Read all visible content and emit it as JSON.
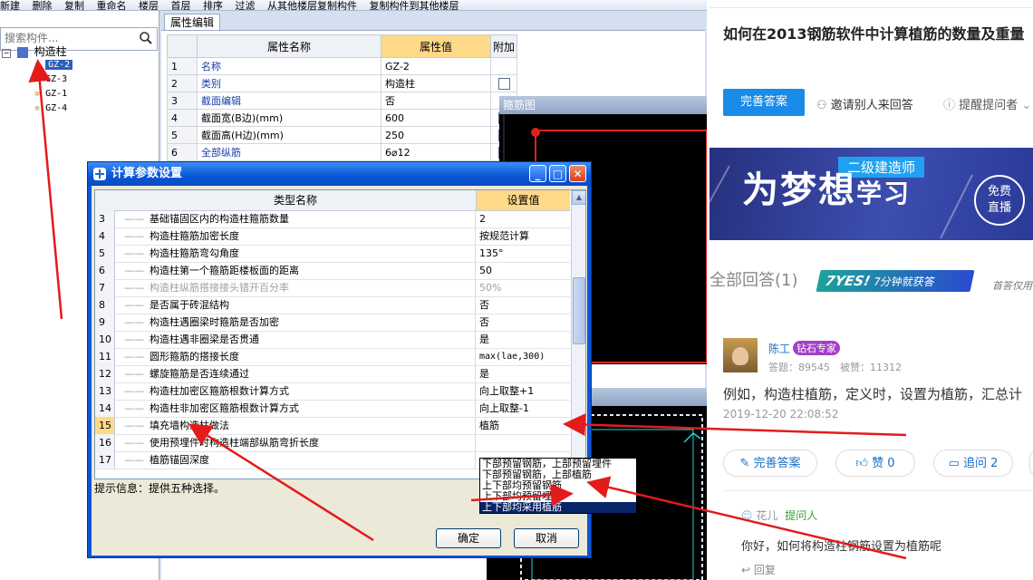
{
  "toolbar": {
    "items": [
      "新建",
      "删除",
      "复制",
      "重命名",
      "楼层",
      "首层",
      "排序",
      "过滤",
      "从其他楼层复制构件",
      "复制构件到其他楼层"
    ]
  },
  "left": {
    "search_placeholder": "搜索构件...",
    "tree_root": "构造柱",
    "tree_items": [
      "GZ-2",
      "GZ-3",
      "GZ-1",
      "GZ-4"
    ],
    "selected_index": 0
  },
  "props": {
    "tab_label": "属性编辑",
    "headers": [
      "属性名称",
      "属性值",
      "附加"
    ],
    "rows": [
      {
        "num": "1",
        "name": "名称",
        "value": "GZ-2",
        "check": false,
        "blue": true
      },
      {
        "num": "2",
        "name": "类别",
        "value": "构造柱",
        "check": true,
        "blue": true
      },
      {
        "num": "3",
        "name": "截面编辑",
        "value": "否",
        "check": false,
        "blue": true
      },
      {
        "num": "4",
        "name": "截面宽(B边)(mm)",
        "value": "600",
        "check": true,
        "blue": false
      },
      {
        "num": "5",
        "name": "截面高(H边)(mm)",
        "value": "250",
        "check": true,
        "blue": false
      },
      {
        "num": "6",
        "name": "全部纵筋",
        "value": "6⌀12",
        "check": true,
        "blue": true
      }
    ]
  },
  "preview": {
    "title": "箍筋图"
  },
  "dialog": {
    "title": "计算参数设置",
    "col_name": "类型名称",
    "col_value": "设置值",
    "rows": [
      {
        "num": "3",
        "name": "基础锚固区内的构造柱箍筋数量",
        "value": "2",
        "dim": false
      },
      {
        "num": "4",
        "name": "构造柱箍筋加密长度",
        "value": "按规范计算",
        "dim": false
      },
      {
        "num": "5",
        "name": "构造柱箍筋弯勾角度",
        "value": "135°",
        "dim": false
      },
      {
        "num": "6",
        "name": "构造柱第一个箍筋距楼板面的距离",
        "value": "50",
        "dim": false
      },
      {
        "num": "7",
        "name": "构造柱纵筋搭接接头错开百分率",
        "value": "50%",
        "dim": true
      },
      {
        "num": "8",
        "name": "是否属于砖混结构",
        "value": "否",
        "dim": false
      },
      {
        "num": "9",
        "name": "构造柱遇圈梁时箍筋是否加密",
        "value": "否",
        "dim": false
      },
      {
        "num": "10",
        "name": "构造柱遇非圈梁是否贯通",
        "value": "是",
        "dim": false
      },
      {
        "num": "11",
        "name": "圆形箍筋的搭接长度",
        "value": "max(lae,300)",
        "dim": false
      },
      {
        "num": "12",
        "name": "螺旋箍筋是否连续通过",
        "value": "是",
        "dim": false
      },
      {
        "num": "13",
        "name": "构造柱加密区箍筋根数计算方式",
        "value": "向上取整+1",
        "dim": false
      },
      {
        "num": "14",
        "name": "构造柱非加密区箍筋根数计算方式",
        "value": "向上取整-1",
        "dim": false
      },
      {
        "num": "15",
        "name": "填充墙构造柱做法",
        "value": "植筋",
        "dim": false
      },
      {
        "num": "16",
        "name": "使用预埋件时构造柱端部纵筋弯折长度",
        "value": "",
        "dim": false
      },
      {
        "num": "17",
        "name": "植筋锚固深度",
        "value": "",
        "dim": false
      }
    ],
    "current_row": "15",
    "dropdown_options": [
      "下部预留钢筋，上部预留埋件",
      "下部预留钢筋，上部植筋",
      "上下部均预留钢筋",
      "上下部均预留埋件",
      "上下部均采用植筋"
    ],
    "dropdown_selected": 4,
    "hint": "提示信息：提供五种选择。",
    "ok": "确定",
    "cancel": "取消"
  },
  "qa": {
    "question_title": "如何在2013钢筋软件中计算植筋的数量及重量",
    "answer_btn": "完善答案",
    "invite": "邀请别人来回答",
    "remind": "提醒提问者",
    "banner_tag": "二级建造师",
    "banner_big1": "为梦",
    "banner_big2": "想",
    "banner_small": "学习",
    "banner_free1": "免费",
    "banner_free2": "直播",
    "all_answers": "全部回答(1)",
    "yes_badge_brand": "7YES!",
    "yes_badge_text": "7分钟就获答",
    "first_only": "首答仅用",
    "user_name": "陈工",
    "expert_badge": "钻石专家",
    "user_stats": "答题：89545　被赞：11312",
    "answer_text": "例如，构造柱植筋，定义时，设置为植筋，汇总计",
    "answer_time": "2019-12-20 22:08:52",
    "btn_improve": "完善答案",
    "btn_like": "赞 0",
    "btn_followup": "追问 2",
    "comment_user": "花儿",
    "comment_role": "提问人",
    "comment_text": "你好，如何将构造柱钢筋设置为植筋呢",
    "reply": "回复"
  },
  "colors": {
    "accent": "#1a8be8",
    "dialog_blue": "#0a56d8",
    "highlight": "#ffd98a",
    "arrow_red": "#e31b1b"
  }
}
